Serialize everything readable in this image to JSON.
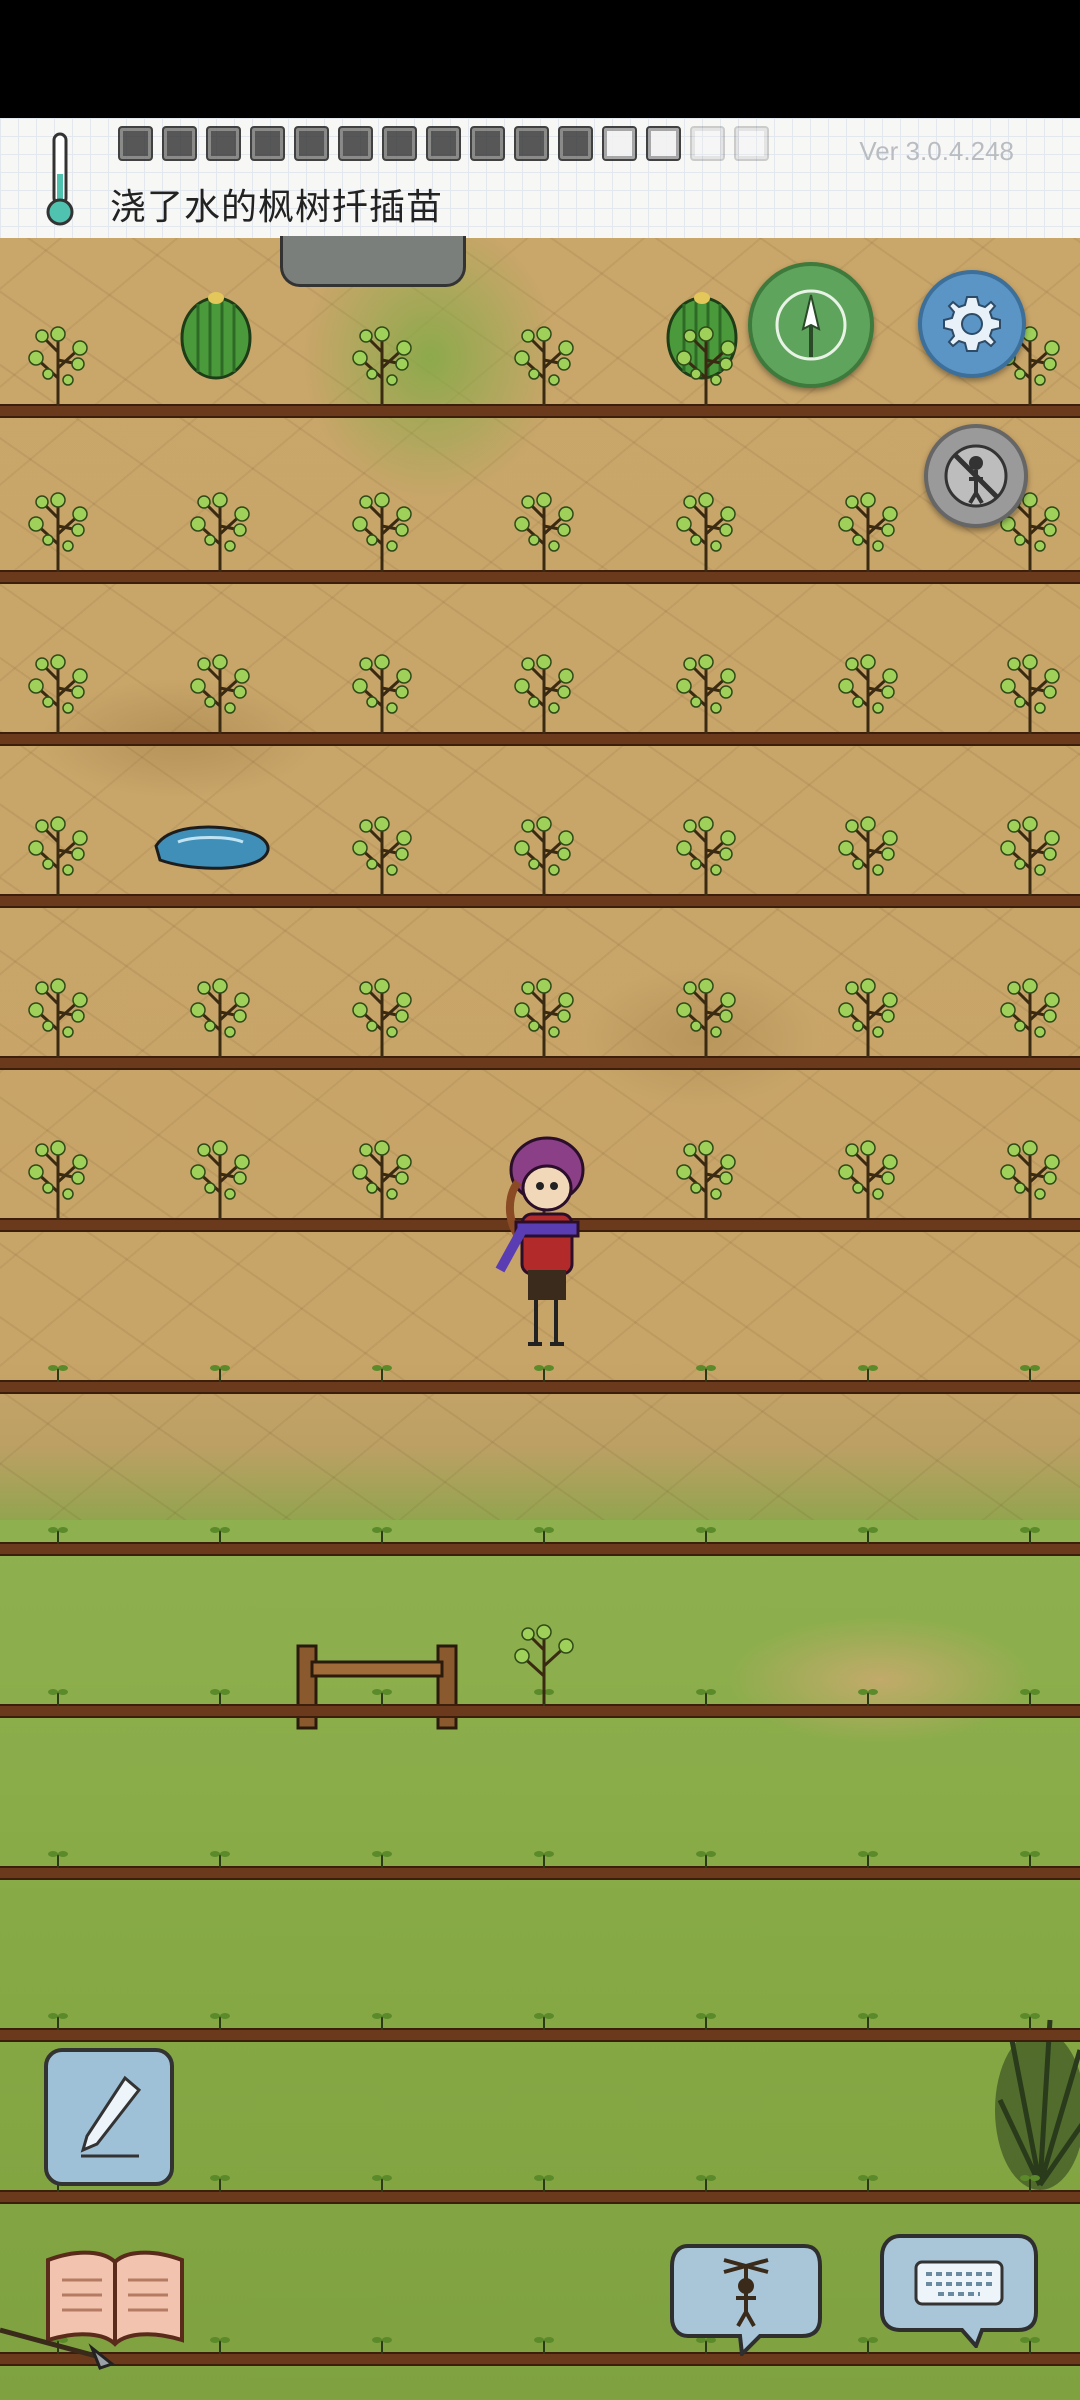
{
  "status_bar": {},
  "header": {
    "inventory_slots": [
      "filled",
      "filled",
      "filled",
      "filled",
      "filled",
      "filled",
      "filled",
      "filled",
      "filled",
      "filled",
      "filled",
      "empty",
      "empty",
      "faded",
      "faded",
      "faded",
      "faded",
      "faded"
    ],
    "version": "Ver 3.0.4.248",
    "message": "浇了水的枫树扦插苗"
  },
  "buttons": {
    "compass": "compass-icon",
    "settings": "gear-icon",
    "puppet_toggle": "puppet-off-icon",
    "journal": "pencil-icon",
    "book": "book-icon",
    "puppet_chat": "puppet-icon",
    "keyboard": "keyboard-icon"
  },
  "colors": {
    "soil": "#c9a66a",
    "grass": "#86a945",
    "row": "#6b3a1c",
    "compass_btn": "#5fa45c",
    "settings_btn": "#5b95c6"
  }
}
